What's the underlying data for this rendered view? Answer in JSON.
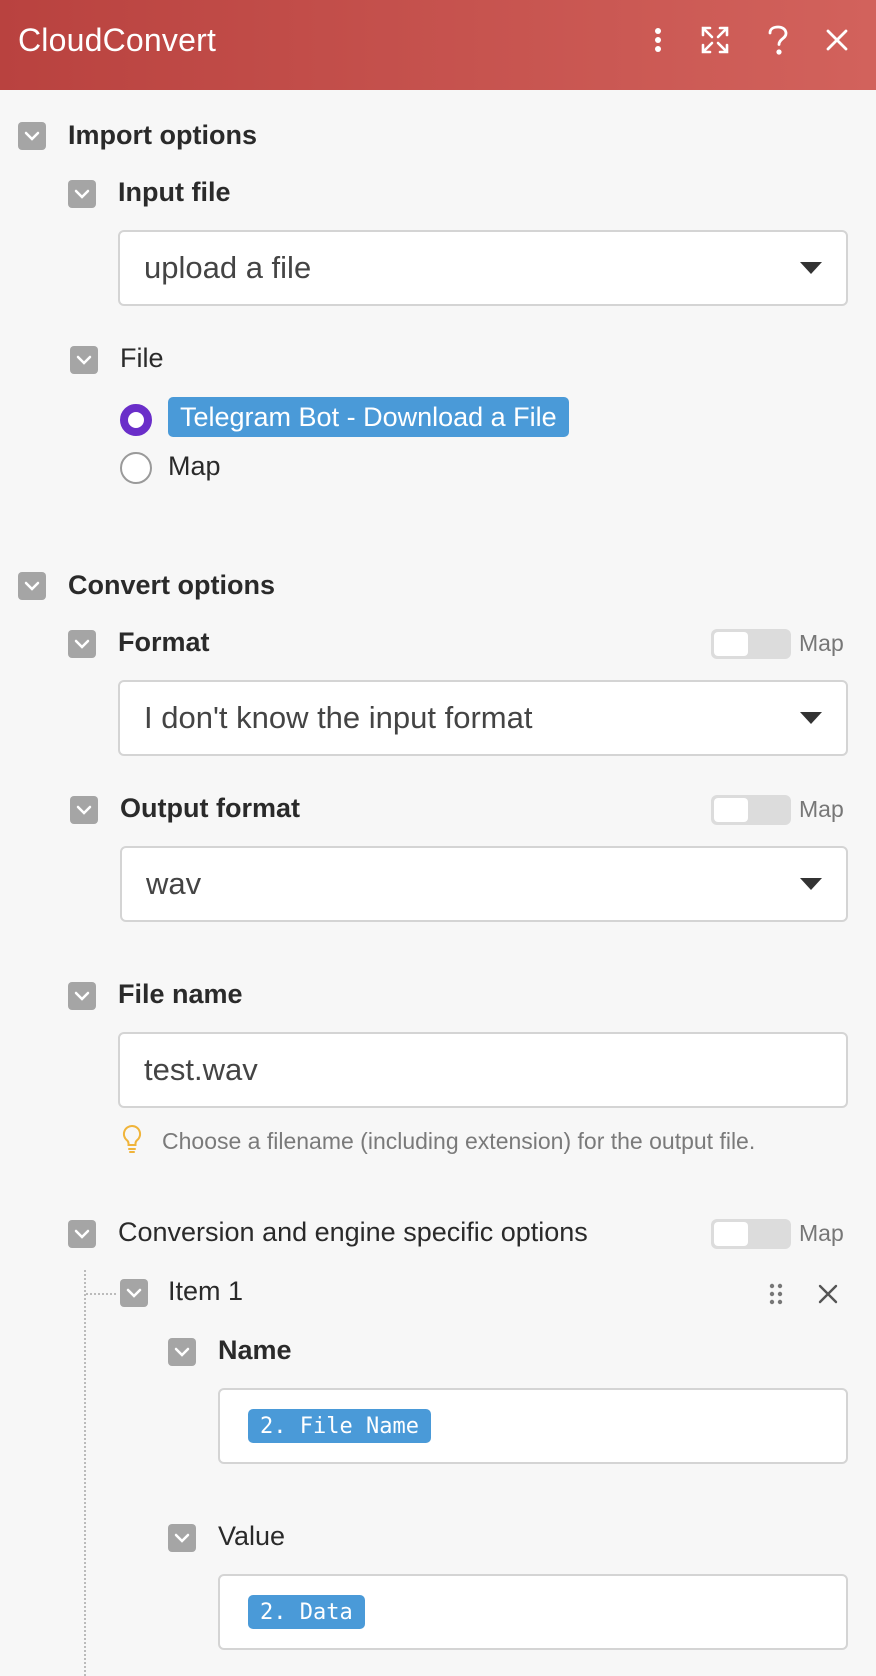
{
  "header": {
    "title": "CloudConvert",
    "icons": [
      "more-vertical-icon",
      "expand-icon",
      "help-icon",
      "close-icon"
    ]
  },
  "import_options": {
    "title": "Import options",
    "input_file": {
      "label": "Input file",
      "value": "upload a file"
    },
    "file": {
      "label": "File",
      "options": [
        {
          "label": "Telegram Bot - Download a File",
          "selected": true
        },
        {
          "label": "Map",
          "selected": false
        }
      ]
    }
  },
  "convert_options": {
    "title": "Convert options",
    "format": {
      "label": "Format",
      "value": "I don't know the input format",
      "map_label": "Map"
    },
    "output_format": {
      "label": "Output format",
      "value": "wav",
      "map_label": "Map"
    },
    "file_name": {
      "label": "File name",
      "value": "test.wav",
      "hint": "Choose a filename (including extension) for the output file."
    },
    "engine_options": {
      "label": "Conversion and engine specific options",
      "map_label": "Map",
      "items": [
        {
          "label": "Item 1",
          "name": {
            "label": "Name",
            "value": "2. File Name"
          },
          "value": {
            "label": "Value",
            "value": "2. Data"
          }
        }
      ]
    }
  },
  "colors": {
    "header_start": "#b9423f",
    "header_end": "#d2625c",
    "pill": "#4a9ad8",
    "radio_selected": "#6a2ec9"
  }
}
